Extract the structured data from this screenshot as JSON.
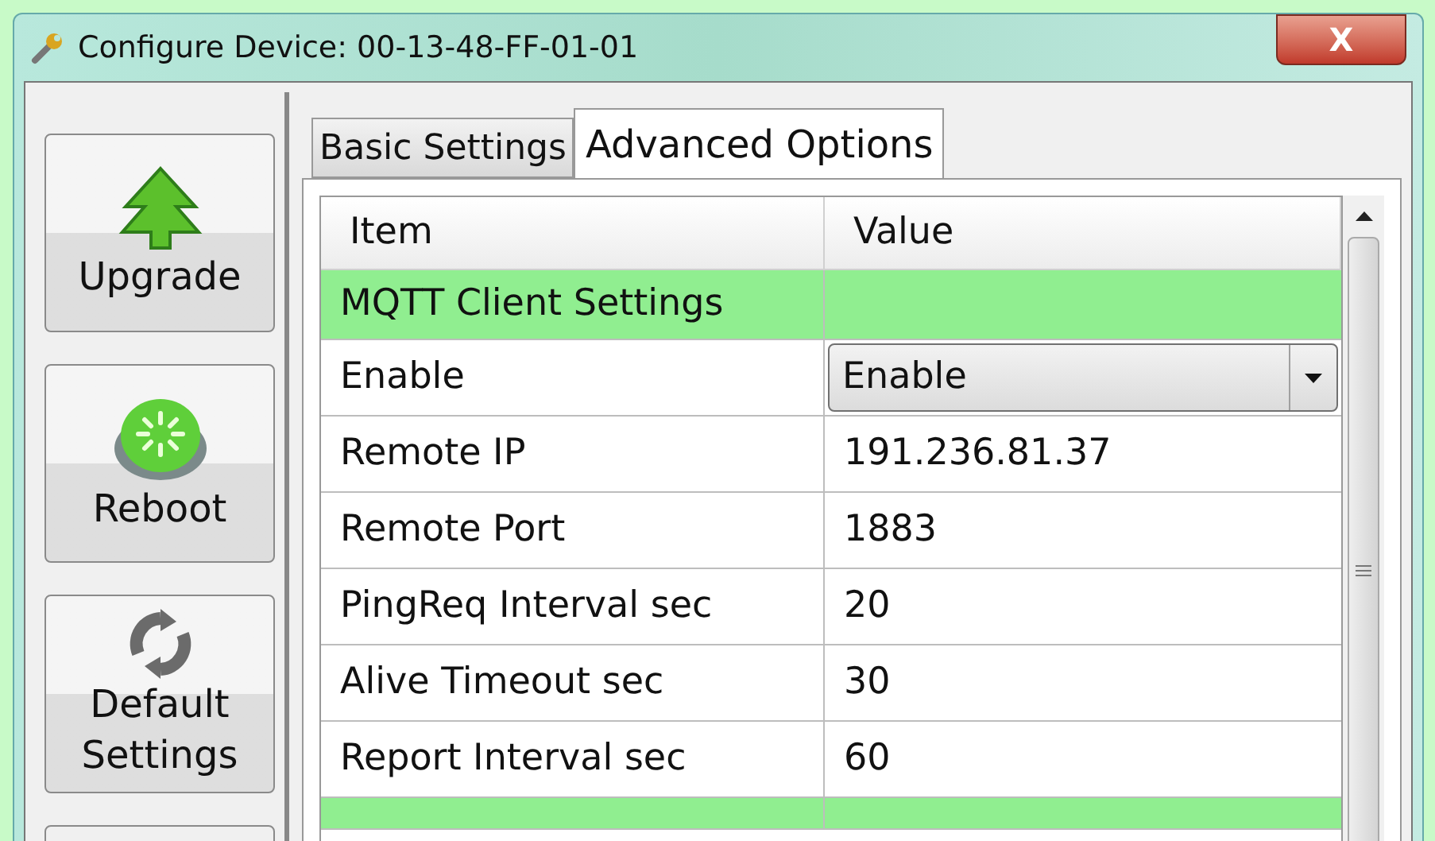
{
  "window": {
    "title": "Configure Device: 00-13-48-FF-01-01",
    "close_label": "X"
  },
  "sidebar": {
    "buttons": [
      {
        "kind": "upgrade",
        "label": "Upgrade"
      },
      {
        "kind": "reboot",
        "label": "Reboot"
      },
      {
        "kind": "default",
        "label": "Default Settings"
      },
      {
        "kind": "partial"
      }
    ]
  },
  "tabs": [
    {
      "label": "Basic Settings",
      "selected": false
    },
    {
      "label": "Advanced Options",
      "selected": true
    }
  ],
  "table": {
    "columns": [
      "Item",
      "Value"
    ],
    "rows": [
      {
        "kind": "section",
        "item": "MQTT Client Settings"
      },
      {
        "kind": "dropdown",
        "item": "Enable",
        "value": "Enable"
      },
      {
        "kind": "text",
        "item": "Remote IP",
        "value": "191.236.81.37"
      },
      {
        "kind": "text",
        "item": "Remote Port",
        "value": "1883"
      },
      {
        "kind": "text",
        "item": "PingReq Interval sec",
        "value": "20"
      },
      {
        "kind": "text",
        "item": "Alive Timeout sec",
        "value": "30"
      },
      {
        "kind": "text",
        "item": "Report Interval sec",
        "value": "60"
      },
      {
        "kind": "section_partial"
      }
    ]
  }
}
